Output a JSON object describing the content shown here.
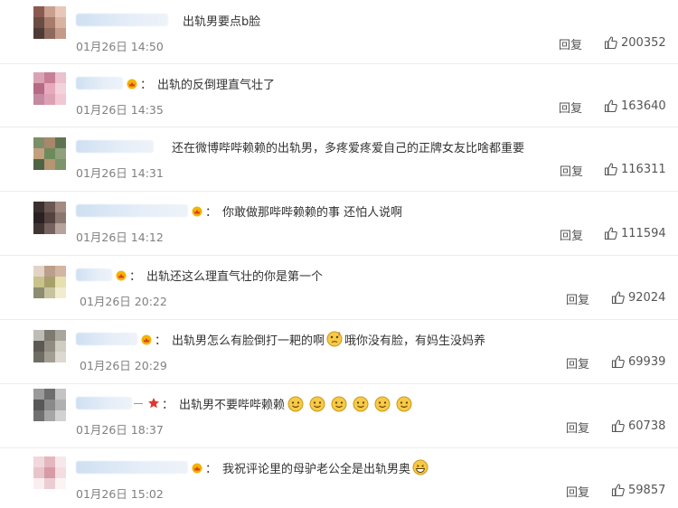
{
  "reply_label": "回复",
  "comments": [
    {
      "text": "出轨男要点b脸",
      "time": "01月26日 14:50",
      "likes": "200352",
      "badge": "none",
      "emoji_count": 0,
      "avatar": [
        "#8a5a50",
        "#c9a08f",
        "#e8c7b8",
        "#6b4c45",
        "#a77c6b",
        "#d9b3a2",
        "#4f3b36",
        "#8f6a5c",
        "#c49b8a"
      ]
    },
    {
      "text": "出轨的反倒理直气壮了",
      "time": "01月26日 14:35",
      "likes": "163640",
      "badge": "crown",
      "emoji_count": 0,
      "avatar": [
        "#d9a3b3",
        "#c77e96",
        "#eac1cd",
        "#b56b85",
        "#e8a9bd",
        "#f2d2dc",
        "#c48aa0",
        "#dca1b4",
        "#f0c7d3"
      ]
    },
    {
      "text": "还在微博哔哔赖赖的出轨男，多疼爱疼爱自己的正牌女友比啥都重要",
      "time": "01月26日 14:31",
      "likes": "116311",
      "badge": "none",
      "emoji_count": 0,
      "avatar": [
        "#7a8f6a",
        "#a8876a",
        "#5f7552",
        "#c1a07e",
        "#6d8a5d",
        "#8fa07c",
        "#4e6445",
        "#b59572",
        "#7c9469"
      ]
    },
    {
      "text": "你敢做那哔哔赖赖的事 还怕人说啊",
      "time": "01月26日 14:12",
      "likes": "111594",
      "badge": "crown",
      "emoji_count": 0,
      "avatar": [
        "#3b2f2f",
        "#6b5652",
        "#a38a82",
        "#2a2222",
        "#544240",
        "#8c7670",
        "#3f3533",
        "#76625e",
        "#b8a39c"
      ]
    },
    {
      "text": "出轨还这么理直气壮的你是第一个",
      "time": "01月26日 20:22",
      "likes": "92024",
      "badge": "crown",
      "emoji_count": 0,
      "avatar": [
        "#e3d3c6",
        "#b99f8c",
        "#d2b5a2",
        "#c9c28a",
        "#a8a06b",
        "#e6e0b0",
        "#8e8c70",
        "#c7c39c",
        "#f1ecd0"
      ]
    },
    {
      "text_before": "出轨男怎么有脸倒打一耙的啊",
      "text_after": "哦你没有脸，有妈生没妈养",
      "time": "01月26日 20:29",
      "likes": "69939",
      "badge": "crown",
      "emoji_count": 1,
      "avatar": [
        "#bdbdb5",
        "#7d7a72",
        "#a9a69c",
        "#5c5952",
        "#908c82",
        "#cfccc2",
        "#6f6c64",
        "#a29e94",
        "#dcd9d0"
      ]
    },
    {
      "text": "出轨男不要哔哔赖赖",
      "time": "01月26日 18:37",
      "likes": "60738",
      "badge": "star",
      "emoji_count": 6,
      "avatar": [
        "#9a9a9a",
        "#6e6e6e",
        "#c4c4c4",
        "#585858",
        "#8a8a8a",
        "#b0b0b0",
        "#707070",
        "#a6a6a6",
        "#d2d2d2"
      ]
    },
    {
      "text": "我祝评论里的母驴老公全是出轨男奥",
      "time": "01月26日 15:02",
      "likes": "59857",
      "badge": "crown",
      "emoji_count": 1,
      "avatar": [
        "#f1d8dc",
        "#e4b7bf",
        "#f7e7ea",
        "#e9c4cb",
        "#d89aa6",
        "#f4dde1",
        "#f9eef0",
        "#eccdd3",
        "#fbf3f4"
      ]
    }
  ]
}
